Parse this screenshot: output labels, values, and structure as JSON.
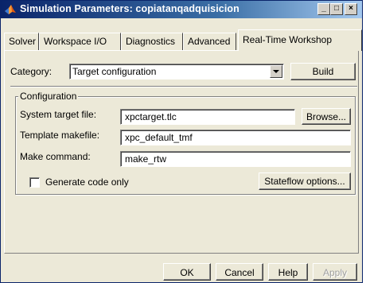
{
  "window": {
    "title": "Simulation Parameters: copiatanqadquisicion",
    "minimize_glyph": "_",
    "maximize_glyph": "□",
    "close_glyph": "×"
  },
  "tabs": [
    {
      "label": "Solver"
    },
    {
      "label": "Workspace I/O"
    },
    {
      "label": "Diagnostics"
    },
    {
      "label": "Advanced"
    },
    {
      "label": "Real-Time Workshop"
    }
  ],
  "category": {
    "label": "Category:",
    "value": "Target configuration",
    "build_label": "Build"
  },
  "configuration": {
    "group_label": "Configuration",
    "system_target_label": "System target file:",
    "system_target_value": "xpctarget.tlc",
    "browse_label": "Browse...",
    "template_makefile_label": "Template makefile:",
    "template_makefile_value": "xpc_default_tmf",
    "make_command_label": "Make command:",
    "make_command_value": "make_rtw",
    "generate_code_only_label": "Generate code only",
    "generate_code_only_checked": false,
    "stateflow_label": "Stateflow options..."
  },
  "footer": {
    "ok_label": "OK",
    "cancel_label": "Cancel",
    "help_label": "Help",
    "apply_label": "Apply"
  },
  "colors": {
    "titlebar_start": "#0a246a",
    "titlebar_end": "#a6caf0",
    "face": "#ece9d8"
  }
}
